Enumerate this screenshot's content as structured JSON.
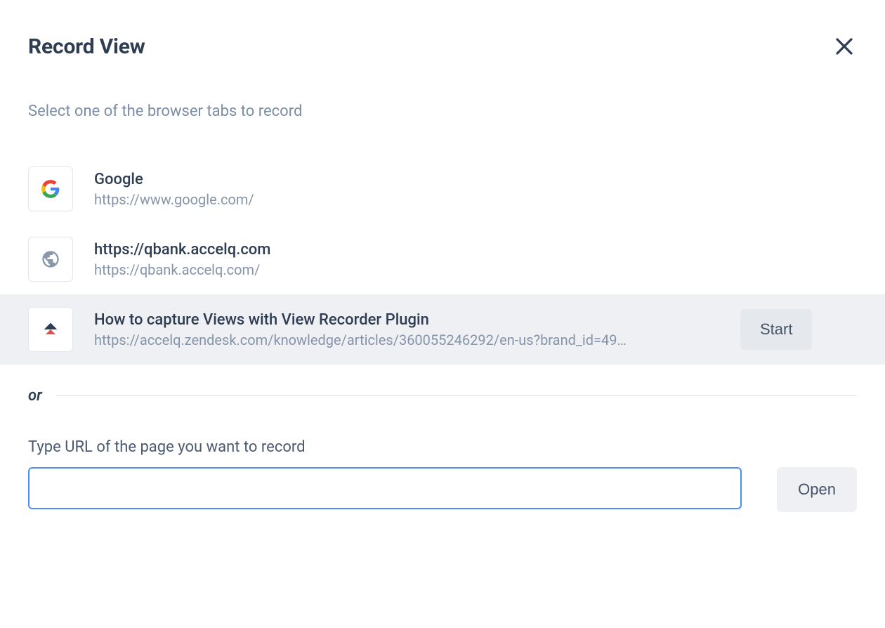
{
  "header": {
    "title": "Record View"
  },
  "instruction": "Select one of the browser tabs to record",
  "tabs": [
    {
      "title": "Google",
      "url": "https://www.google.com/",
      "icon": "google",
      "highlighted": false
    },
    {
      "title": "https://qbank.accelq.com",
      "url": "https://qbank.accelq.com/",
      "icon": "globe",
      "highlighted": false
    },
    {
      "title": "How to capture Views with View Recorder Plugin",
      "url": "https://accelq.zendesk.com/knowledge/articles/360055246292/en-us?brand_id=49…",
      "icon": "accelq",
      "highlighted": true
    }
  ],
  "start_label": "Start",
  "divider_label": "or",
  "url_section": {
    "label": "Type URL of the page you want to record",
    "value": "",
    "open_label": "Open"
  }
}
